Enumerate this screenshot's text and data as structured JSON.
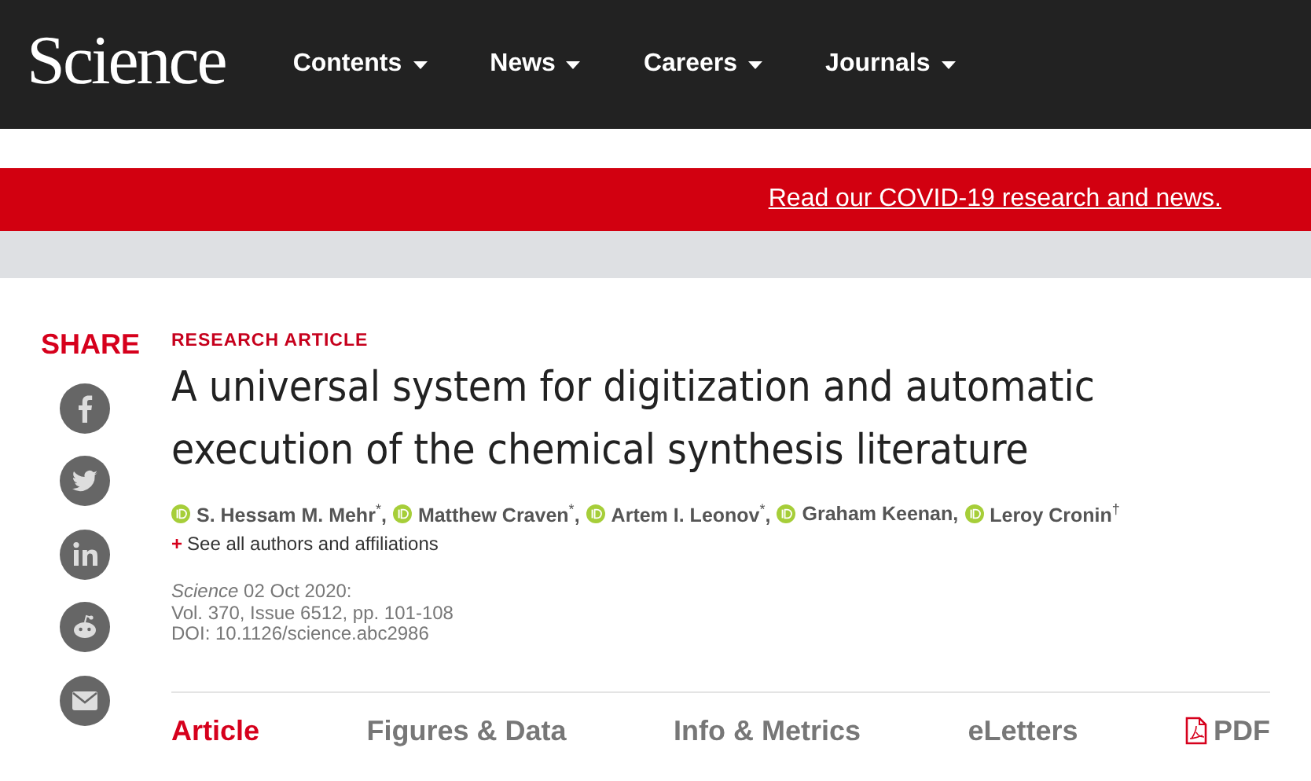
{
  "header": {
    "logo": "Science",
    "nav": [
      "Contents",
      "News",
      "Careers",
      "Journals"
    ]
  },
  "banner": {
    "link": "Read our COVID-19 research and news."
  },
  "share": {
    "label": "SHARE"
  },
  "article": {
    "type": "RESEARCH ARTICLE",
    "title": "A universal system for digitization and automatic execution of the chemical synthesis literature",
    "authors": [
      "S. Hessam M. Mehr$^{*}$,",
      "Matthew Craven$^{*}$,",
      "Artem I. Leonov$^{*}$,",
      "Graham Keenan,",
      "Leroy Cronin$^{†}$"
    ],
    "see_all": {
      "mark": "+",
      "text": "See all authors and affiliations"
    },
    "journal": "Science",
    "date": "02 Oct 2020:",
    "volume": "Vol. 370, Issue 6512, pp. 101-108",
    "doi": "DOI: 10.1126/science.abc2986"
  },
  "tabs": [
    {
      "label": "Article",
      "selected": true,
      "kind": "text"
    },
    {
      "label": "Figures & Data",
      "selected": false,
      "kind": "text"
    },
    {
      "label": "Info & Metrics",
      "selected": false,
      "kind": "text"
    },
    {
      "label": "eLetters",
      "selected": false,
      "kind": "text"
    },
    {
      "label": "PDF",
      "selected": false,
      "kind": "pdf"
    }
  ]
}
